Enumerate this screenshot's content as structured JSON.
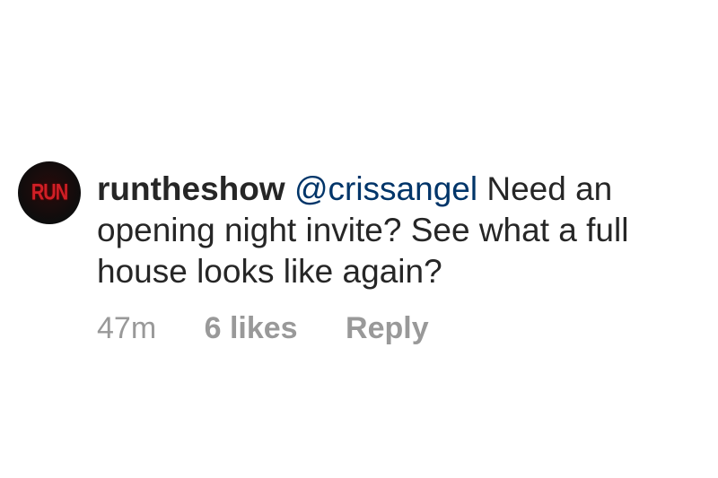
{
  "comment": {
    "avatar_logo_text": "RUN",
    "username": "runtheshow",
    "mention": "@crissangel",
    "text_line1": " Need an",
    "text_line2": "opening night invite?  See what a full",
    "text_line3": "house looks like again?",
    "time": "47m",
    "likes": "6 likes",
    "reply": "Reply"
  }
}
